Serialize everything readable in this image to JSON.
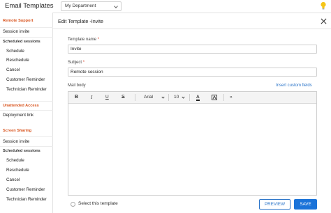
{
  "header": {
    "app_title": "Email Templates",
    "department": "My Department"
  },
  "sidebar": {
    "remote_support": "Remote Support",
    "rs_item_session_invite": "Session invite",
    "rs_scheduled": "Scheduled sessions",
    "rs_schedule": "Schedule",
    "rs_reschedule": "Reschedule",
    "rs_cancel": "Cancel",
    "rs_customer_reminder": "Customer Reminder",
    "rs_technician_reminder": "Technician Reminder",
    "unattended": "Unattended Access",
    "deployment_link": "Deployment link",
    "screen_sharing": "Screen Sharing",
    "ss_item_session_invite": "Session invite",
    "ss_scheduled": "Scheduled sessions",
    "ss_schedule": "Schedule",
    "ss_reschedule": "Reschedule",
    "ss_cancel": "Cancel",
    "ss_customer_reminder": "Customer Reminder",
    "ss_technician_reminder": "Technician Reminder"
  },
  "main": {
    "title": "Edit Template -Invite",
    "template_name_label": "Template name",
    "template_name_value": "Invite",
    "subject_label": "Subject",
    "subject_value": "Remote session",
    "mail_body_label": "Mail body",
    "insert_custom_fields": "Insert custom fields",
    "required_mark": "*"
  },
  "toolbar": {
    "bold": "B",
    "italic": "I",
    "underline": "U",
    "strike": "S",
    "font": "Arial",
    "size": "10",
    "font_color": "A",
    "more": "»"
  },
  "footer": {
    "select_label": "Select this template",
    "preview": "PREVIEW",
    "save": "SAVE"
  },
  "colors": {
    "accent": "#1a73d9",
    "group_heading": "#d9541e"
  }
}
